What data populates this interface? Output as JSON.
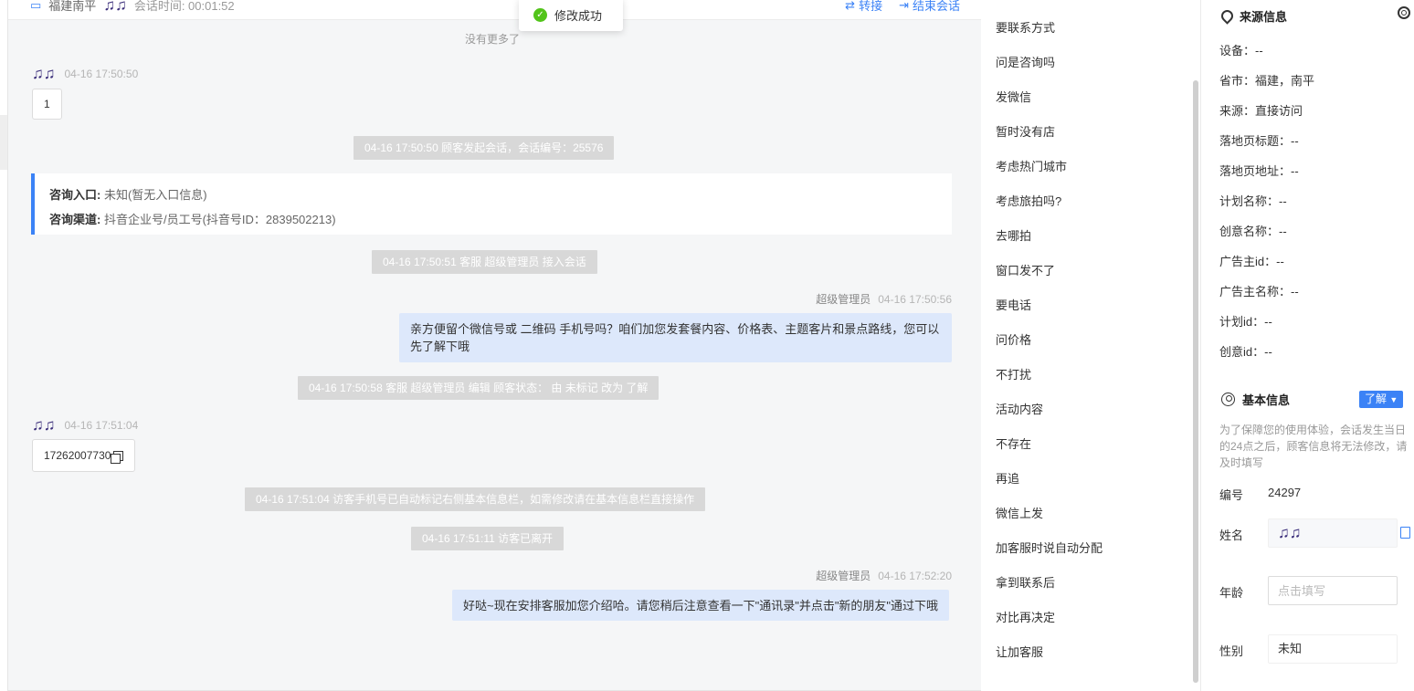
{
  "toast": {
    "text": "修改成功"
  },
  "header": {
    "location": "福建南平",
    "timer": "会话时间: 00:01:52",
    "transfer": "转接",
    "end": "结束会话"
  },
  "chat": {
    "no_more": "没有更多了",
    "messages": [
      {
        "type": "client",
        "time": "04-16 17:50:50",
        "text": "1"
      },
      {
        "type": "system",
        "text": "04-16 17:50:50 顾客发起会话，会话编号：25576"
      },
      {
        "type": "info",
        "entry_label": "咨询入口:",
        "entry_value": "未知(暂无入口信息)",
        "channel_label": "咨询渠道:",
        "channel_value": "抖音企业号/员工号(抖音号ID：2839502213)"
      },
      {
        "type": "system",
        "text": "04-16 17:50:51 客服 超级管理员 接入会话"
      },
      {
        "type": "agent",
        "name": "超级管理员",
        "time": "04-16 17:50:56",
        "text": "亲方便留个微信号或 二维码 手机号吗？咱们加您发套餐内容、价格表、主题客片和景点路线，您可以先了解下哦"
      },
      {
        "type": "system",
        "text": "04-16 17:50:58 客服 超级管理员 编辑 顾客状态： 由 未标记 改为 了解"
      },
      {
        "type": "client",
        "time": "04-16 17:51:04",
        "text": "17262007730"
      },
      {
        "type": "system",
        "text": "04-16 17:51:04 访客手机号已自动标记右侧基本信息栏，如需修改请在基本信息栏直接操作"
      },
      {
        "type": "system",
        "text": "04-16 17:51:11 访客已离开"
      },
      {
        "type": "agent",
        "name": "超级管理员",
        "time": "04-16 17:52:20",
        "text": "好哒~现在安排客服加您介绍哈。请您稍后注意查看一下\"通讯录\"并点击\"新的朋友\"通过下哦"
      }
    ]
  },
  "phrases": [
    "要联系方式",
    "问是咨询吗",
    "发微信",
    "暂时没有店",
    "考虑热门城市",
    "考虑旅拍吗?",
    "去哪拍",
    "窗口发不了",
    "要电话",
    "问价格",
    "不打扰",
    "活动内容",
    "不存在",
    "再追",
    "微信上发",
    "加客服时说自动分配",
    "拿到联系后",
    "对比再决定",
    "让加客服"
  ],
  "source": {
    "title": "来源信息",
    "rows": [
      "设备：--",
      "省市：福建，南平",
      "来源：直接访问",
      "落地页标题：--",
      "落地页地址：--",
      "计划名称：--",
      "创意名称：--",
      "广告主id：--",
      "广告主名称：--",
      "计划id：--",
      "创意id：--"
    ]
  },
  "basic": {
    "title": "基本信息",
    "status": "了解",
    "note": "为了保障您的使用体验，会话发生当日的24点之后，顾客信息将无法修改，请及时填写",
    "id_label": "编号",
    "id_value": "24297",
    "name_label": "姓名",
    "age_label": "年龄",
    "age_placeholder": "点击填写",
    "gender_label": "性别",
    "gender_value": "未知"
  },
  "colors": {
    "accent": "#3b82f6",
    "success": "#52c41a",
    "agent_bubble": "#dde8fb",
    "system_bg": "#d8d8d8"
  }
}
